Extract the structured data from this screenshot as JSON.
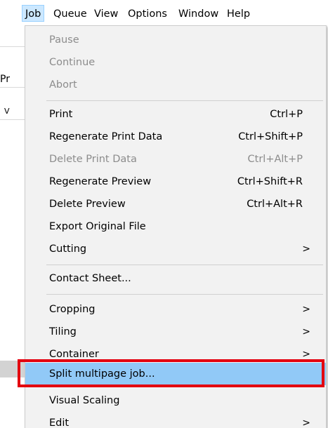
{
  "menubar": {
    "items": [
      {
        "label": "Job",
        "active": true
      },
      {
        "label": "Queue"
      },
      {
        "label": "View"
      },
      {
        "label": "Options"
      },
      {
        "label": "Window"
      },
      {
        "label": "Help"
      }
    ]
  },
  "background": {
    "frag1": "Pr",
    "frag2": "V"
  },
  "job_menu": {
    "items": [
      {
        "label": "Pause",
        "shortcut": "",
        "disabled": true
      },
      {
        "label": "Continue",
        "shortcut": "",
        "disabled": true
      },
      {
        "label": "Abort",
        "shortcut": "",
        "disabled": true
      },
      {
        "label": "Print",
        "shortcut": "Ctrl+P"
      },
      {
        "label": "Regenerate Print Data",
        "shortcut": "Ctrl+Shift+P"
      },
      {
        "label": "Delete Print Data",
        "shortcut": "Ctrl+Alt+P",
        "disabled": true
      },
      {
        "label": "Regenerate Preview",
        "shortcut": "Ctrl+Shift+R"
      },
      {
        "label": "Delete Preview",
        "shortcut": "Ctrl+Alt+R"
      },
      {
        "label": "Export Original File",
        "shortcut": ""
      },
      {
        "label": "Cutting",
        "shortcut": "",
        "submenu": true
      },
      {
        "label": "Contact Sheet...",
        "shortcut": ""
      },
      {
        "label": "Cropping",
        "shortcut": "",
        "submenu": true
      },
      {
        "label": "Tiling",
        "shortcut": "",
        "submenu": true
      },
      {
        "label": "Container",
        "shortcut": "",
        "submenu": true
      },
      {
        "label": "Split multipage job...",
        "shortcut": "",
        "highlighted": true
      },
      {
        "label": "Visual Scaling",
        "shortcut": ""
      },
      {
        "label": "Edit",
        "shortcut": "",
        "submenu": true
      }
    ],
    "submenu_arrow": ">"
  },
  "colors": {
    "highlight_row": "#91c9f7",
    "annotation_box": "#e3000f",
    "menu_bg": "#f2f2f2",
    "disabled_text": "#8c8c8c"
  }
}
